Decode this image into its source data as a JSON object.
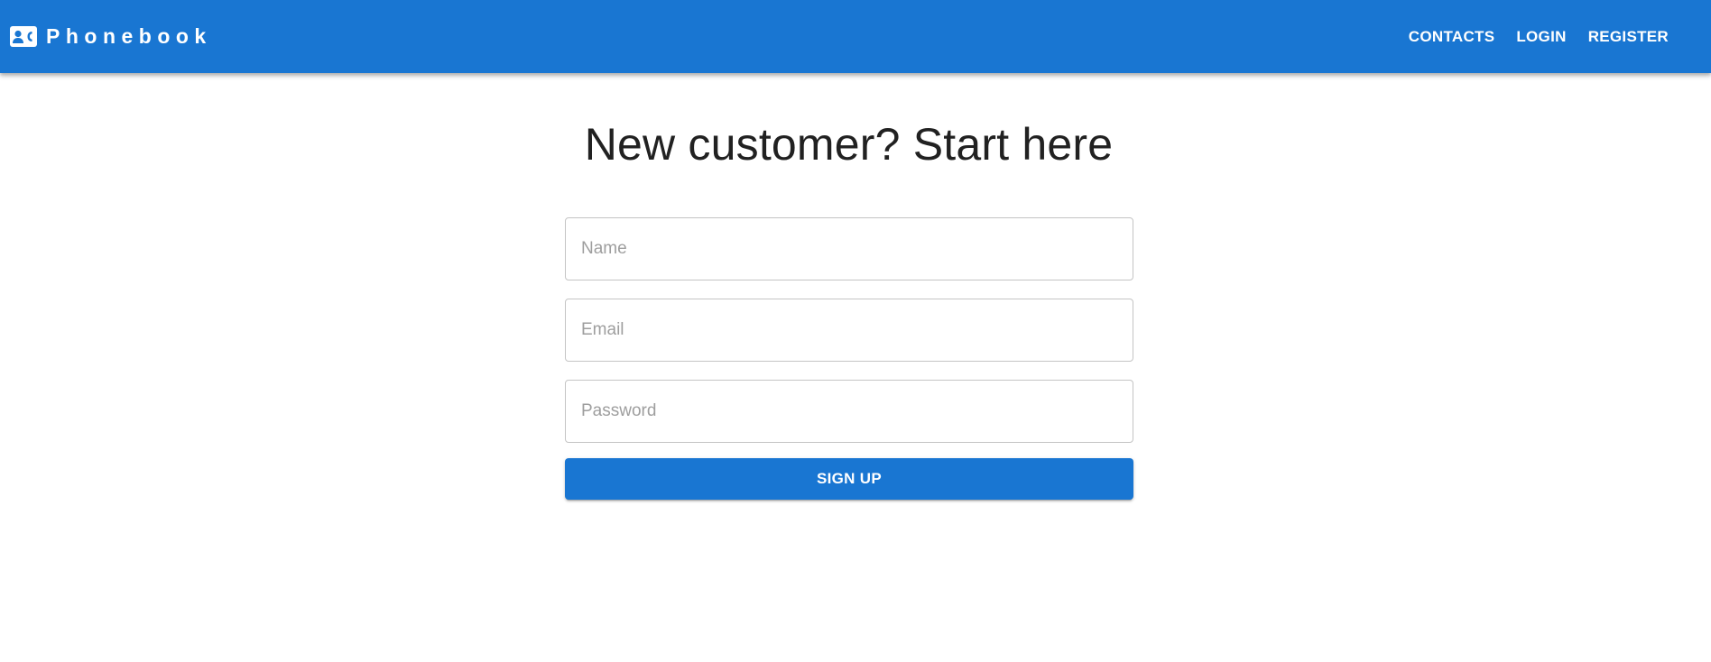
{
  "header": {
    "brand_icon": "contact-card-icon",
    "brand_title": "Phonebook",
    "nav": [
      {
        "label": "Contacts"
      },
      {
        "label": "Login"
      },
      {
        "label": "Register"
      }
    ]
  },
  "main": {
    "title": "New customer? Start here",
    "fields": {
      "name": {
        "placeholder": "Name",
        "value": ""
      },
      "email": {
        "placeholder": "Email",
        "value": ""
      },
      "password": {
        "placeholder": "Password",
        "value": ""
      }
    },
    "submit_label": "Sign up"
  },
  "colors": {
    "primary": "#1976d2",
    "heading": "#212121",
    "placeholder": "#9e9e9e",
    "border": "#c4c4c4"
  }
}
